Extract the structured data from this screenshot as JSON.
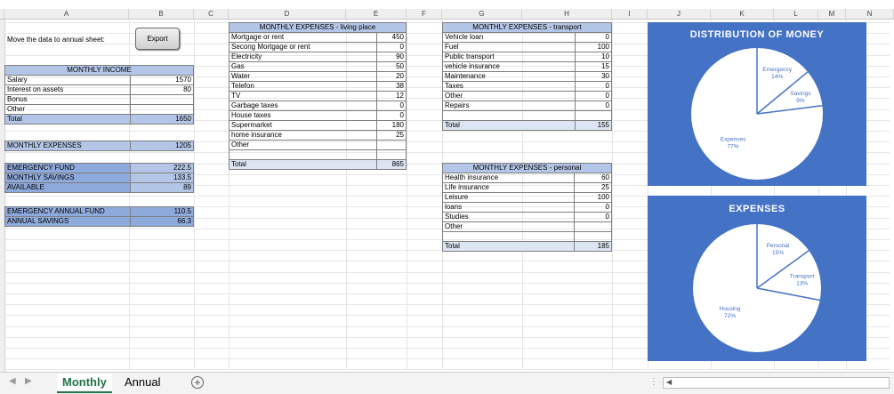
{
  "columns": [
    "A",
    "B",
    "C",
    "D",
    "E",
    "F",
    "G",
    "H",
    "I",
    "J",
    "K",
    "L",
    "M",
    "N"
  ],
  "export_section": {
    "label": "Move the data to annual sheet:",
    "button_label": "Export"
  },
  "income": {
    "header": "MONTHLY INCOME",
    "rows": [
      {
        "label": "Salary",
        "value": "1570"
      },
      {
        "label": "Interest on assets",
        "value": "80"
      },
      {
        "label": "Bonus",
        "value": ""
      },
      {
        "label": "Other",
        "value": ""
      }
    ],
    "total_label": "Total",
    "total_value": "1650"
  },
  "monthly_expenses": {
    "label": "MONTHLY EXPENSES",
    "value": "1205"
  },
  "funds": [
    {
      "label": "EMERGENCY FUND",
      "value": "222.5"
    },
    {
      "label": "MONTHLY SAVINGS",
      "value": "133.5"
    },
    {
      "label": "AVAILABLE",
      "value": "89"
    }
  ],
  "annual": [
    {
      "label": "EMERGENCY ANNUAL FUND",
      "value": "110.5"
    },
    {
      "label": "ANNUAL SAVINGS",
      "value": "66.3"
    }
  ],
  "living": {
    "header": "MONTHLY EXPENSES - living place",
    "rows": [
      {
        "label": "Mortgage or rent",
        "value": "450"
      },
      {
        "label": "Secong Mortgage or rent",
        "value": "0"
      },
      {
        "label": "Electricity",
        "value": "90"
      },
      {
        "label": "Gas",
        "value": "50"
      },
      {
        "label": "Water",
        "value": "20"
      },
      {
        "label": "Telefon",
        "value": "38"
      },
      {
        "label": "TV",
        "value": "12"
      },
      {
        "label": "Garbage taxes",
        "value": "0"
      },
      {
        "label": "House taxes",
        "value": "0"
      },
      {
        "label": "Supermarket",
        "value": "180"
      },
      {
        "label": "home insurance",
        "value": "25"
      },
      {
        "label": "Other",
        "value": ""
      },
      {
        "label": "",
        "value": ""
      }
    ],
    "total_label": "Total",
    "total_value": "865"
  },
  "transport": {
    "header": "MONTHLY EXPENSES - transport",
    "rows": [
      {
        "label": "Vehicle loan",
        "value": "0"
      },
      {
        "label": "Fuel",
        "value": "100"
      },
      {
        "label": "Public transport",
        "value": "10"
      },
      {
        "label": "vehicle insurance",
        "value": "15"
      },
      {
        "label": "Maintenance",
        "value": "30"
      },
      {
        "label": "Taxes",
        "value": "0"
      },
      {
        "label": "Other",
        "value": "0"
      },
      {
        "label": "Repairs",
        "value": "0"
      },
      {
        "label": "",
        "value": ""
      }
    ],
    "total_label": "Total",
    "total_value": "155"
  },
  "personal": {
    "header": "MONTHLY EXPENSES - personal",
    "rows": [
      {
        "label": "Health insurance",
        "value": "60"
      },
      {
        "label": "Life insurance",
        "value": "25"
      },
      {
        "label": "Leisure",
        "value": "100"
      },
      {
        "label": "loans",
        "value": "0"
      },
      {
        "label": "Studies",
        "value": "0"
      },
      {
        "label": "Other",
        "value": ""
      },
      {
        "label": "",
        "value": ""
      }
    ],
    "total_label": "Total",
    "total_value": "185"
  },
  "chart_data": [
    {
      "type": "pie",
      "title": "DISTRIBUTION OF MONEY",
      "categories": [
        "Emergency",
        "Savings",
        "Expenses"
      ],
      "values": [
        14,
        9,
        77
      ],
      "labels": [
        "14%",
        "9%",
        "77%"
      ],
      "colors": {
        "background": "#4472c4",
        "slice": "#ffffff",
        "line": "#4472c4",
        "text": "#4472c4"
      }
    },
    {
      "type": "pie",
      "title": "EXPENSES",
      "categories": [
        "Personal",
        "Transport",
        "Housing"
      ],
      "values": [
        15,
        13,
        72
      ],
      "labels": [
        "15%",
        "13%",
        "72%"
      ],
      "colors": {
        "background": "#4472c4",
        "slice": "#ffffff",
        "line": "#4472c4",
        "text": "#4472c4"
      }
    }
  ],
  "sheet_tabs": [
    {
      "label": "Monthly",
      "active": true
    },
    {
      "label": "Annual",
      "active": false
    }
  ],
  "add_sheet_icon": "plus-circle-icon",
  "accent_color": "#217346"
}
